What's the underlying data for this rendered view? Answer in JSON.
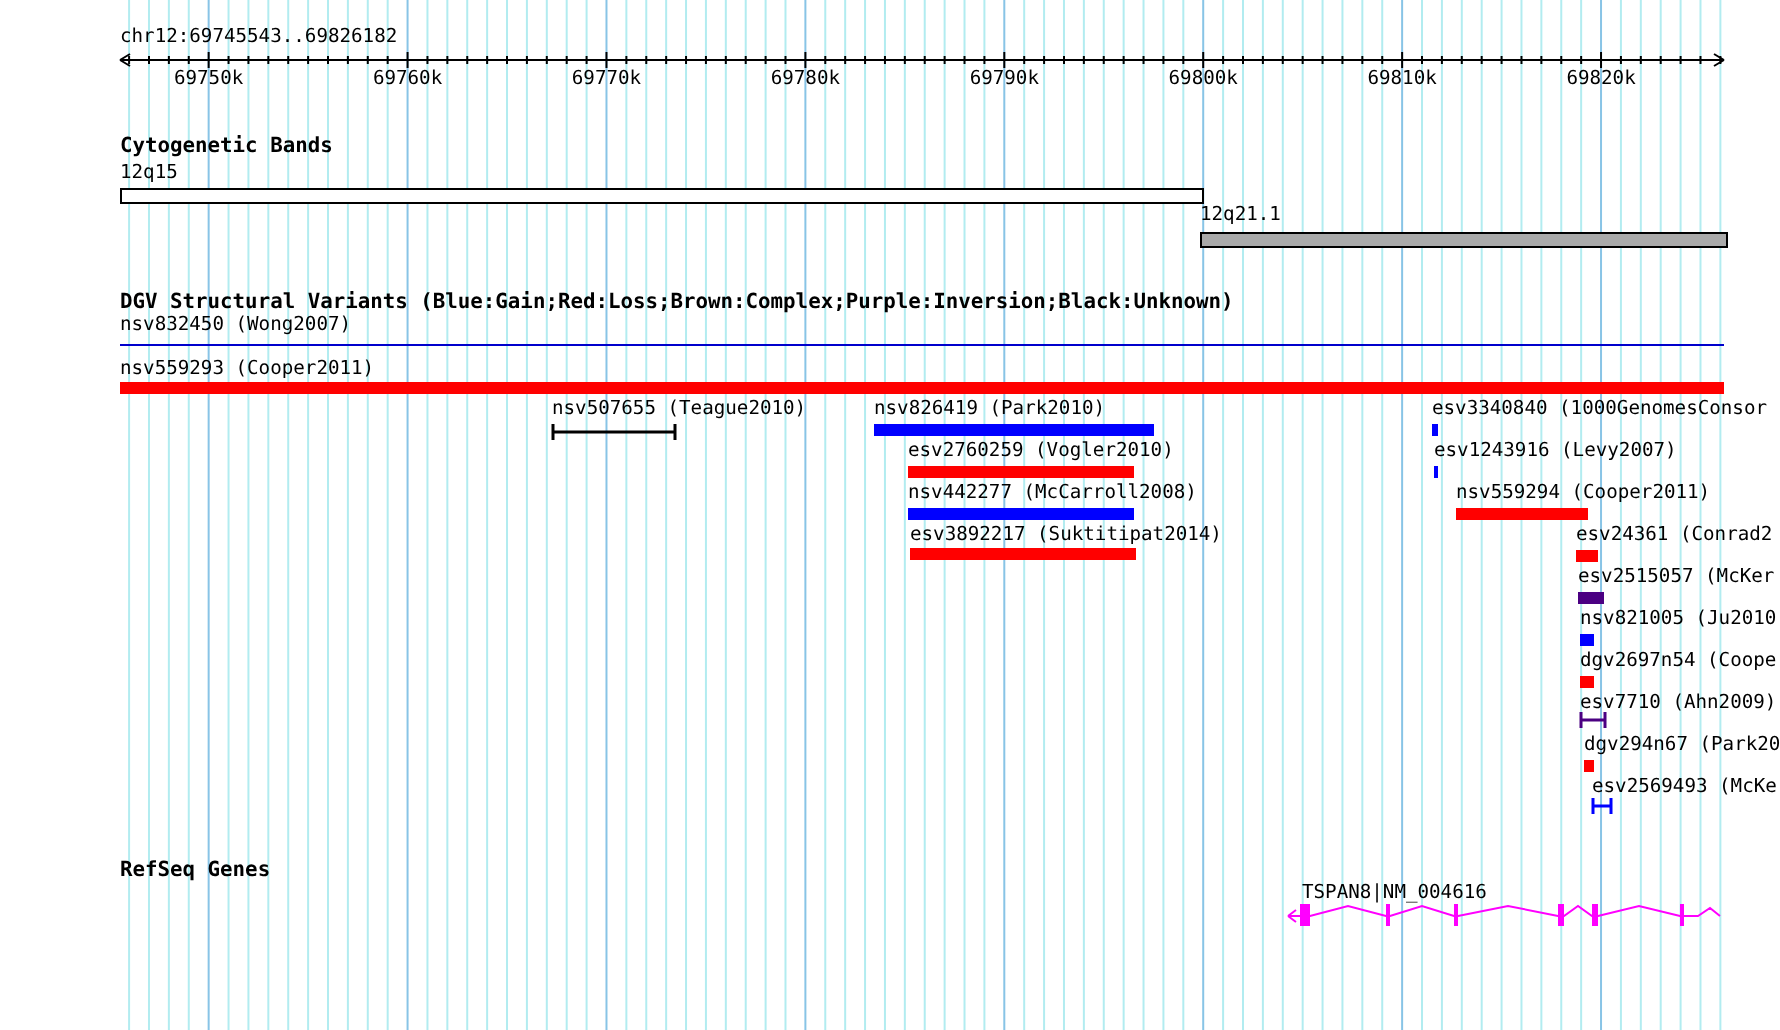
{
  "ruler": {
    "label": "chr12:69745543..69826182",
    "ticks": [
      "69750k",
      "69760k",
      "69770k",
      "69780k",
      "69790k",
      "69800k",
      "69810k",
      "69820k"
    ]
  },
  "cytogenetic_bands": {
    "title": "Cytogenetic Bands",
    "bands": [
      {
        "label": "12q15",
        "color": "#ffffff"
      },
      {
        "label": "12q21.1",
        "color": "#aaaaaa"
      }
    ]
  },
  "structural_variants": {
    "title": "DGV Structural Variants (Blue:Gain;Red:Loss;Brown:Complex;Purple:Inversion;Black:Unknown)",
    "variants": [
      {
        "label": "nsv832450 (Wong2007)",
        "kind": "line",
        "color": "#0000cc"
      },
      {
        "label": "nsv559293 (Cooper2011)",
        "kind": "bar",
        "color": "#ff0000"
      },
      {
        "label": "nsv507655 (Teague2010)",
        "kind": "span",
        "color": "#000000"
      },
      {
        "label": "nsv826419 (Park2010)",
        "kind": "bar",
        "color": "#0000ff"
      },
      {
        "label": "esv2760259 (Vogler2010)",
        "kind": "bar",
        "color": "#ff0000"
      },
      {
        "label": "nsv442277 (McCarroll2008)",
        "kind": "bar",
        "color": "#0000ff"
      },
      {
        "label": "esv3892217 (Suktitipat2014)",
        "kind": "bar",
        "color": "#ff0000"
      },
      {
        "label": "esv3340840 (1000GenomesConsor",
        "kind": "bar",
        "color": "#0000ff"
      },
      {
        "label": "esv1243916 (Levy2007)",
        "kind": "bar",
        "color": "#0000ff"
      },
      {
        "label": "nsv559294 (Cooper2011)",
        "kind": "bar",
        "color": "#ff0000"
      },
      {
        "label": "esv24361 (Conrad2",
        "kind": "bar",
        "color": "#ff0000"
      },
      {
        "label": "esv2515057 (McKer",
        "kind": "bar",
        "color": "#4b0082"
      },
      {
        "label": "nsv821005 (Ju2010",
        "kind": "bar",
        "color": "#0000ff"
      },
      {
        "label": "dgv2697n54 (Coope",
        "kind": "bar",
        "color": "#ff0000"
      },
      {
        "label": "esv7710 (Ahn2009)",
        "kind": "span",
        "color": "#4b0082"
      },
      {
        "label": "dgv294n67 (Park20",
        "kind": "bar",
        "color": "#ff0000"
      },
      {
        "label": "esv2569493 (McKe",
        "kind": "span",
        "color": "#0000ff"
      }
    ]
  },
  "refseq_genes": {
    "title": "RefSeq Genes",
    "genes": [
      {
        "label": "TSPAN8|NM_004616"
      }
    ]
  }
}
